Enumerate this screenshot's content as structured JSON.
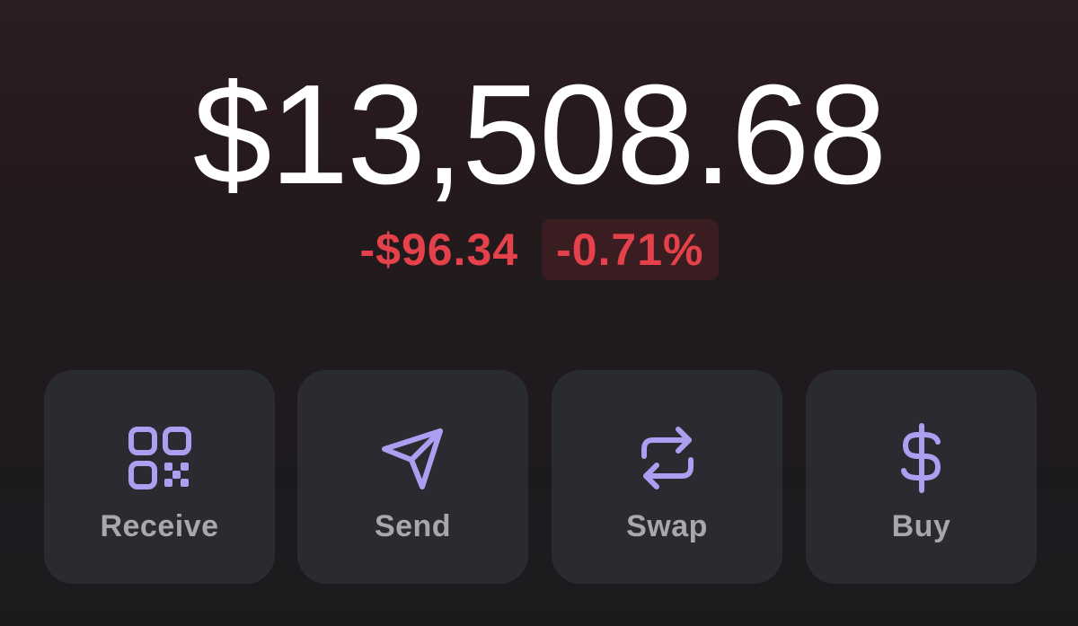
{
  "balance": {
    "total": "$13,508.68",
    "change_amount": "-$96.34",
    "change_percent": "-0.71%"
  },
  "actions": [
    {
      "label": "Receive",
      "icon": "qr-code-icon"
    },
    {
      "label": "Send",
      "icon": "paper-plane-icon"
    },
    {
      "label": "Swap",
      "icon": "swap-arrows-icon"
    },
    {
      "label": "Buy",
      "icon": "dollar-icon"
    }
  ],
  "colors": {
    "accent": "#ab9ff2",
    "negative": "#e5414a",
    "negative_badge_bg": "#3a1d21",
    "button_bg": "#2a2b30",
    "label": "#a7a8ad"
  }
}
